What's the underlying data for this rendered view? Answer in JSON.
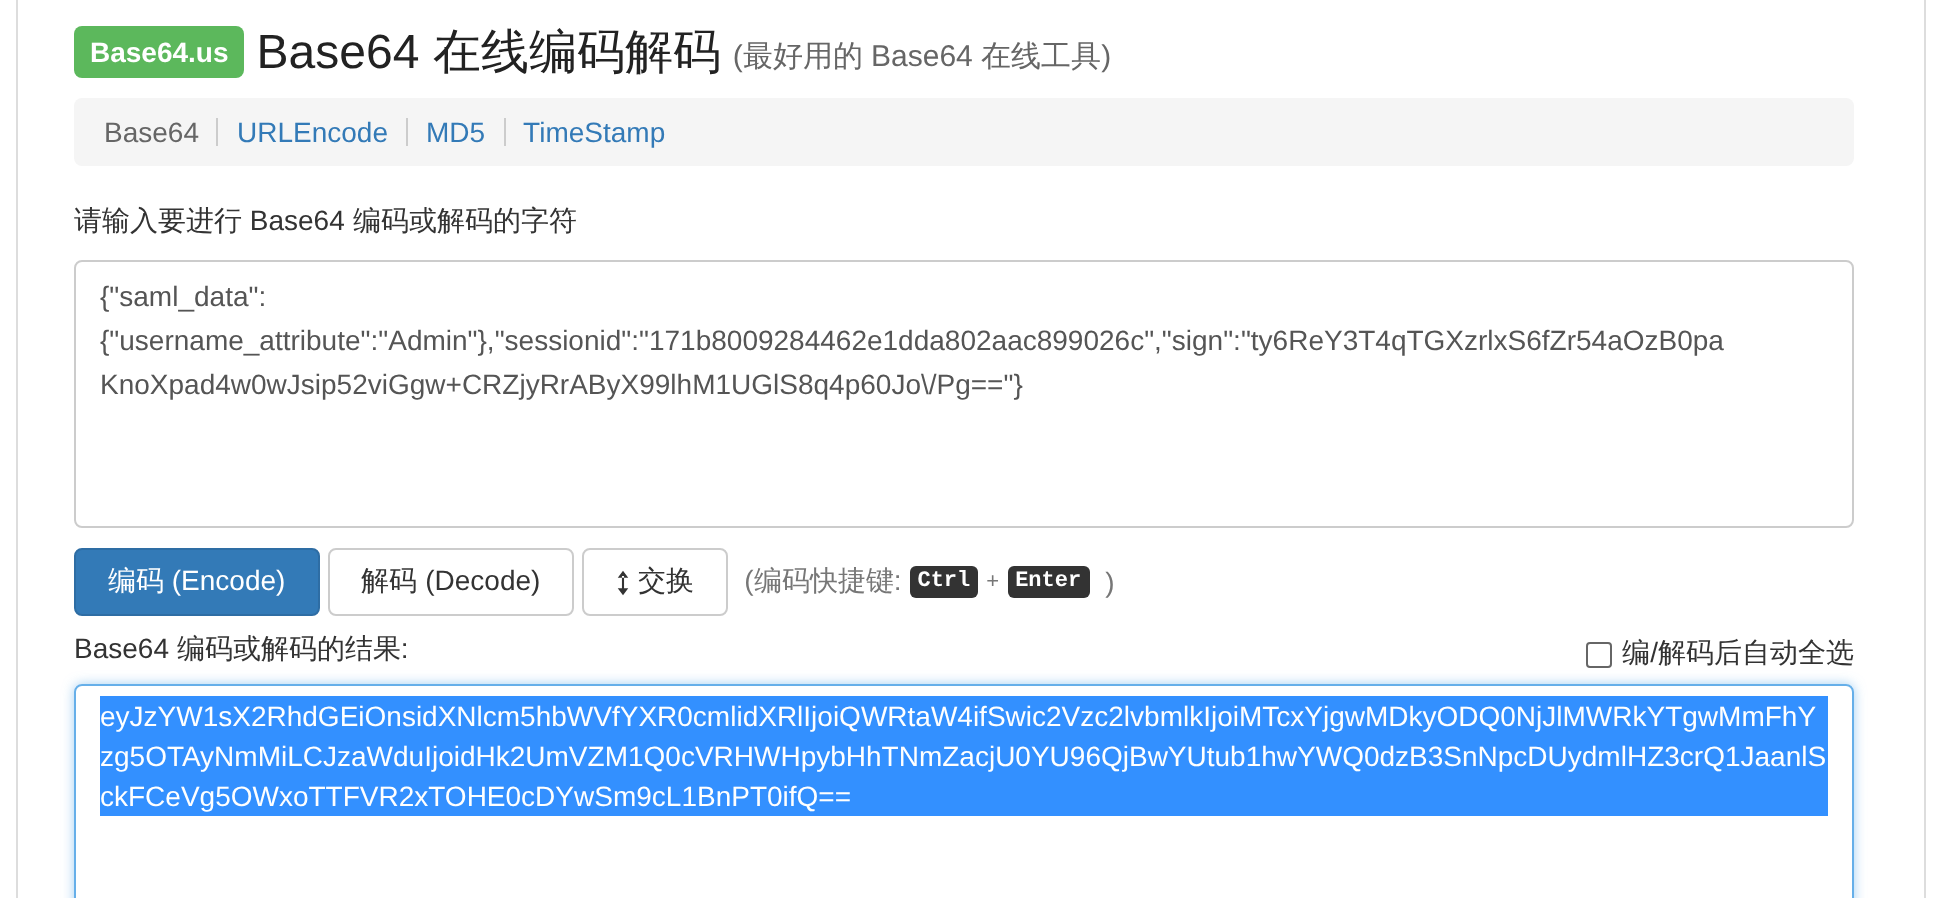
{
  "brand": {
    "badge": "Base64.us",
    "title": "Base64 在线编码解码",
    "subtitle": "(最好用的 Base64 在线工具)"
  },
  "nav": [
    {
      "label": "Base64",
      "selected": true
    },
    {
      "label": "URLEncode",
      "selected": false
    },
    {
      "label": "MD5",
      "selected": false
    },
    {
      "label": "TimeStamp",
      "selected": false
    }
  ],
  "input": {
    "label": "请输入要进行 Base64 编码或解码的字符",
    "value": "{\"saml_data\":\n{\"username_attribute\":\"Admin\"},\"sessionid\":\"171b8009284462e1dda802aac899026c\",\"sign\":\"ty6ReY3T4qTGXzrlxS6fZr54aOzB0pa\nKnoXpad4w0wJsip52viGgw+CRZjyRrAByX99lhM1UGlS8q4p60Jo\\/Pg==\"}"
  },
  "buttons": [
    {
      "kind": "primary",
      "label": "编码 (Encode)"
    },
    {
      "kind": "default",
      "label": "解码 (Decode)"
    },
    {
      "kind": "swap",
      "label": "交换"
    }
  ],
  "shortcut": {
    "prefix": "(编码快捷键:",
    "keys": [
      "Ctrl",
      "Enter"
    ],
    "plus": "+",
    "suffix": ")"
  },
  "output": {
    "label": "Base64 编码或解码的结果:",
    "auto_select": {
      "label": "编/解码后自动全选",
      "checked": false
    },
    "value": "eyJzYW1sX2RhdGEiOnsidXNlcm5hbWVfYXR0cmlidXRlIjoiQWRtaW4ifSwic2Vzc2lvbmlkIjoiMTcxYjgwMDkyODQ0NjJlMWRkYTgwMmFhYzg5OTAyNmMiLCJzaWduIjoidHk2UmVZM1Q0cVRHWHpybHhTNmZacjU0YU96QjBwYUtub1hwYWQ0dzB3SnNpcDUydmlHZ3crQ1JaanlSckFCeVg5OWxoTTFVR2xTOHE0cDYwSm9cL1BnPT0ifQ==",
    "selected": true
  }
}
